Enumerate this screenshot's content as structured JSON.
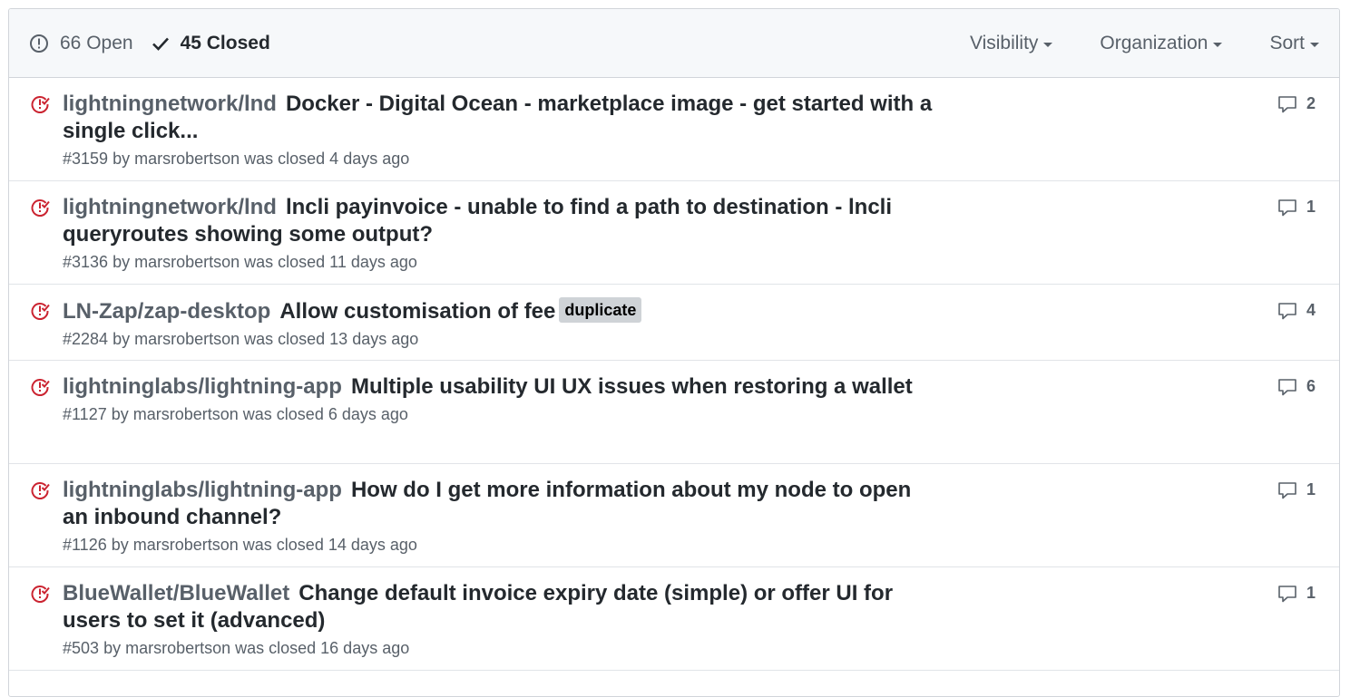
{
  "header": {
    "open_label": "66 Open",
    "closed_label": "45 Closed",
    "filters": [
      "Visibility",
      "Organization",
      "Sort"
    ]
  },
  "issues": [
    {
      "repo": "lightningnetwork/lnd",
      "title": "Docker - Digital Ocean - marketplace image - get started with a single click...",
      "label": "",
      "number": "#3159",
      "meta": "by marsrobertson was closed 4 days ago",
      "comments": "2"
    },
    {
      "repo": "lightningnetwork/lnd",
      "title": "lncli payinvoice - unable to find a path to destination - lncli queryroutes showing some output?",
      "label": "",
      "number": "#3136",
      "meta": "by marsrobertson was closed 11 days ago",
      "comments": "1"
    },
    {
      "repo": "LN-Zap/zap-desktop",
      "title": "Allow customisation of fee",
      "label": "duplicate",
      "number": "#2284",
      "meta": "by marsrobertson was closed 13 days ago",
      "comments": "4"
    },
    {
      "repo": "lightninglabs/lightning-app",
      "title": "Multiple usability UI UX issues when restoring a wallet",
      "label": "",
      "number": "#1127",
      "meta": "by marsrobertson was closed 6 days ago",
      "comments": "6"
    },
    {
      "repo": "lightninglabs/lightning-app",
      "title": "How do I get more information about my node to open an inbound channel?",
      "label": "",
      "number": "#1126",
      "meta": "by marsrobertson was closed 14 days ago",
      "comments": "1"
    },
    {
      "repo": "BlueWallet/BlueWallet",
      "title": "Change default invoice expiry date (simple) or offer UI for users to set it (advanced)",
      "label": "",
      "number": "#503",
      "meta": "by marsrobertson was closed 16 days ago",
      "comments": "1"
    }
  ],
  "colors": {
    "closed_icon": "#cb2431",
    "muted_text": "#586069",
    "label_bg": "#cfd3d7"
  }
}
